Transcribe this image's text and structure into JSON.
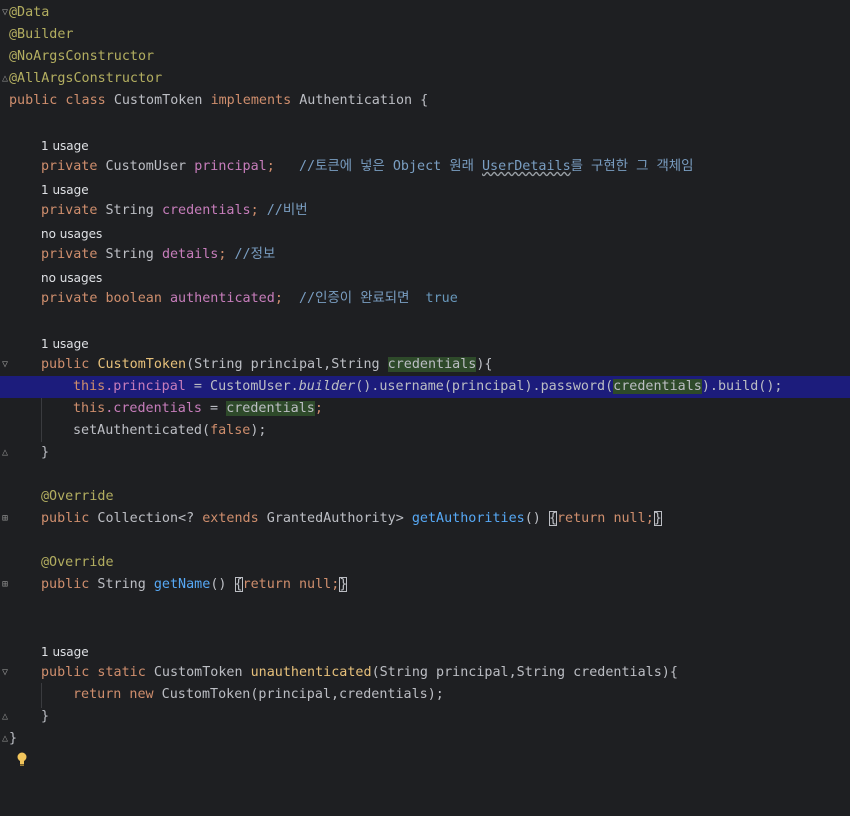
{
  "editor": {
    "lines": [
      {
        "annotation": "@Data"
      },
      {
        "annotation": "@Builder"
      },
      {
        "annotation": "@NoArgsConstructor"
      },
      {
        "annotation": "@AllArgsConstructor"
      },
      {
        "kw1": "public class",
        "name": "CustomToken",
        "kw2": "implements",
        "iface": "Authentication {"
      },
      {
        "hint": "1 usage"
      },
      {
        "kw": "private",
        "type": "CustomUser",
        "field": "principal",
        "semi": ";",
        "comment_a": "//토큰에 넣은 Object 원래 ",
        "comment_b": "UserDetails",
        "comment_c": "를 구현한 그 객체임"
      },
      {
        "hint": "1 usage"
      },
      {
        "kw": "private",
        "type": "String",
        "field": "credentials",
        "semi": ";",
        "comment": "//비번"
      },
      {
        "hint": "no usages"
      },
      {
        "kw": "private",
        "type": "String",
        "field": "details",
        "semi": ";",
        "comment": "//정보"
      },
      {
        "hint": "no usages"
      },
      {
        "kw": "private",
        "type": "boolean",
        "field": "authenticated",
        "semi": ";",
        "comment": "//인증이 완료되면",
        "comment_kw": "true"
      },
      {
        "hint": "1 usage"
      },
      {
        "kw": "public",
        "name": "CustomToken",
        "args_a": "(String principal,String ",
        "args_b": "credentials",
        "args_c": "){"
      },
      {
        "t1": "this",
        "t2": ".principal",
        "t3": " = CustomUser.",
        "t4": "builder",
        "t5": "().username(principal).password(",
        "t6": "credentials",
        "t7": ").build();"
      },
      {
        "t1": "this",
        "t2": ".credentials",
        "t3": " = ",
        "t4": "credentials",
        "t5": ";"
      },
      {
        "t1": "setAuthenticated(",
        "t2": "false",
        "t3": ");"
      },
      {
        "code": "}"
      },
      {
        "annotation": "@Override"
      },
      {
        "kw": "public",
        "t1": " Collection<? ",
        "t2": "extends",
        "t3": " GrantedAuthority> ",
        "name": "getAuthorities",
        "t4": "() ",
        "b1": "{",
        "ret": "return",
        "nul": "null",
        "b2": "}"
      },
      {
        "annotation": "@Override"
      },
      {
        "kw": "public",
        "t1": " String ",
        "name": "getName",
        "t4": "() ",
        "b1": "{",
        "ret": "return",
        "nul": "null",
        "b2": "}"
      },
      {
        "hint": "1 usage"
      },
      {
        "kw": "public static",
        "t1": " CustomToken ",
        "name": "unauthenticated",
        "t4": "(String principal,String credentials){"
      },
      {
        "ret": "return new",
        "t1": " CustomToken(principal,credentials);"
      },
      {
        "code": "}"
      },
      {
        "code": "}"
      }
    ]
  },
  "colors": {
    "background": "#1e1f22",
    "highlight_line": "#1c1c7c",
    "keyword": "#cf8e6d",
    "annotation": "#b3ae60",
    "field": "#c77dbb",
    "method": "#56a8f5",
    "comment": "#7a9ec2"
  },
  "icons": {
    "bulb": "lightbulb-icon",
    "fold": "fold-marker-icon"
  }
}
